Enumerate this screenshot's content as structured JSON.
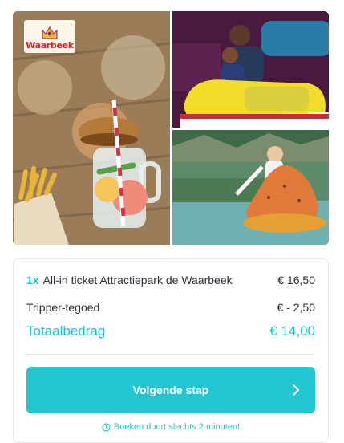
{
  "gallery": {
    "logo_text": "Waarbeek",
    "images": [
      {
        "alt": "Drink with fries on wooden table"
      },
      {
        "alt": "Father and child in bumper car"
      },
      {
        "alt": "Child in bumper boat"
      }
    ]
  },
  "order": {
    "ticket_qty": "1x",
    "ticket_label": "All-in ticket Attractiepark de Waarbeek",
    "ticket_price": "€ 16,50",
    "credit_label": "Tripper-tegoed",
    "credit_value": "€ - 2,50",
    "total_label": "Totaalbedrag",
    "total_value": "€ 14,00"
  },
  "actions": {
    "next_label": "Volgende stap",
    "note": "Boeken duurt slechts 2 minuten!"
  },
  "colors": {
    "accent": "#23c5d0",
    "logo_red": "#d31e2e"
  }
}
